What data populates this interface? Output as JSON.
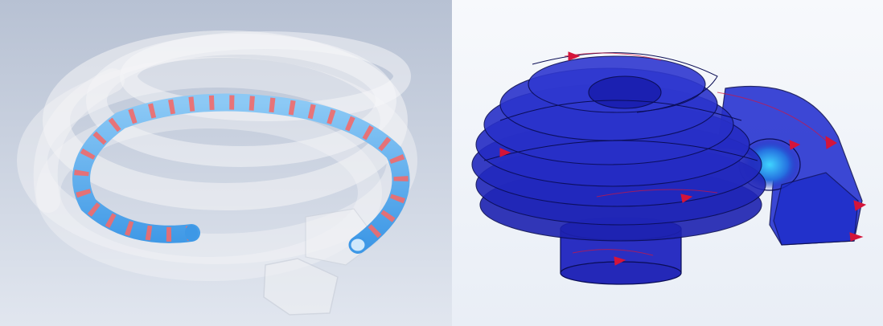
{
  "figure": {
    "left_panel": {
      "content": "cad-render",
      "colors": {
        "background_top": "#b9c3d4",
        "background_bottom": "#dfe5ee",
        "coil": "#5aaef0",
        "bands": "#f26a6a",
        "housing": "#f2f2f2"
      }
    },
    "right_panel": {
      "content": "simulation-render",
      "colors": {
        "background": "#f4f7fb",
        "body": "#1a1fb8",
        "highlight": "#35c8ff",
        "arrows": "#d4143a"
      }
    }
  }
}
